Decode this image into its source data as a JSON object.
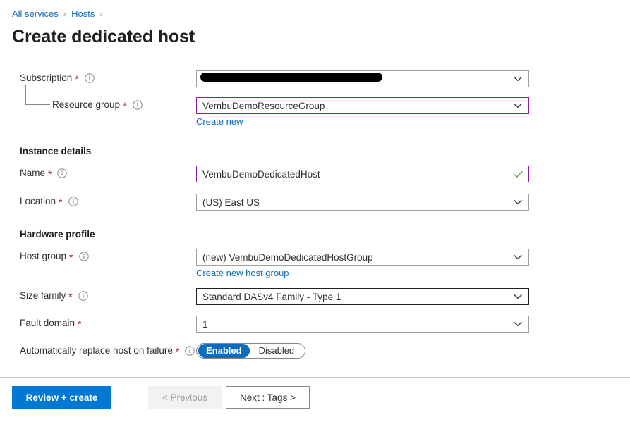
{
  "breadcrumb": {
    "items": [
      "All services",
      "Hosts"
    ],
    "separator": "›"
  },
  "page_title": "Create dedicated host",
  "project_details": {
    "fields": [
      {
        "label": "Subscription",
        "required": "*",
        "value": "",
        "redacted": true,
        "state": "default",
        "control": "dropdown"
      },
      {
        "label": "Resource group",
        "required": "*",
        "value": "VembuDemoResourceGroup",
        "redacted": false,
        "state": "focused",
        "control": "dropdown",
        "sublink": "Create new"
      }
    ]
  },
  "instance_details": {
    "heading": "Instance details",
    "fields": [
      {
        "label": "Name",
        "required": "*",
        "value": "VembuDemoDedicatedHost",
        "state": "focused",
        "control": "textbox-valid"
      },
      {
        "label": "Location",
        "required": "*",
        "value": "(US) East US",
        "state": "default",
        "control": "dropdown"
      }
    ]
  },
  "hardware_profile": {
    "heading": "Hardware profile",
    "fields": [
      {
        "label": "Host group",
        "required": "*",
        "value": "(new) VembuDemoDedicatedHostGroup",
        "state": "default",
        "control": "dropdown",
        "sublink": "Create new host group"
      },
      {
        "label": "Size family",
        "required": "*",
        "value": "Standard DASv4 Family - Type 1",
        "state": "hovered",
        "control": "dropdown"
      },
      {
        "label": "Fault domain",
        "required": "*",
        "value": "1",
        "state": "default",
        "control": "dropdown"
      }
    ],
    "toggle": {
      "label": "Automatically replace host on failure",
      "required": "*",
      "options": [
        "Enabled",
        "Disabled"
      ],
      "selected": "Enabled"
    }
  },
  "footer": {
    "review_create": "Review + create",
    "previous": "< Previous",
    "next": "Next : Tags >"
  },
  "colors": {
    "accent_blue": "#0078d4",
    "link_blue": "#0f6cbd",
    "focus_purple": "#8a1fa8",
    "valid_green": "#5ba83c",
    "required_red": "#a4262c"
  }
}
